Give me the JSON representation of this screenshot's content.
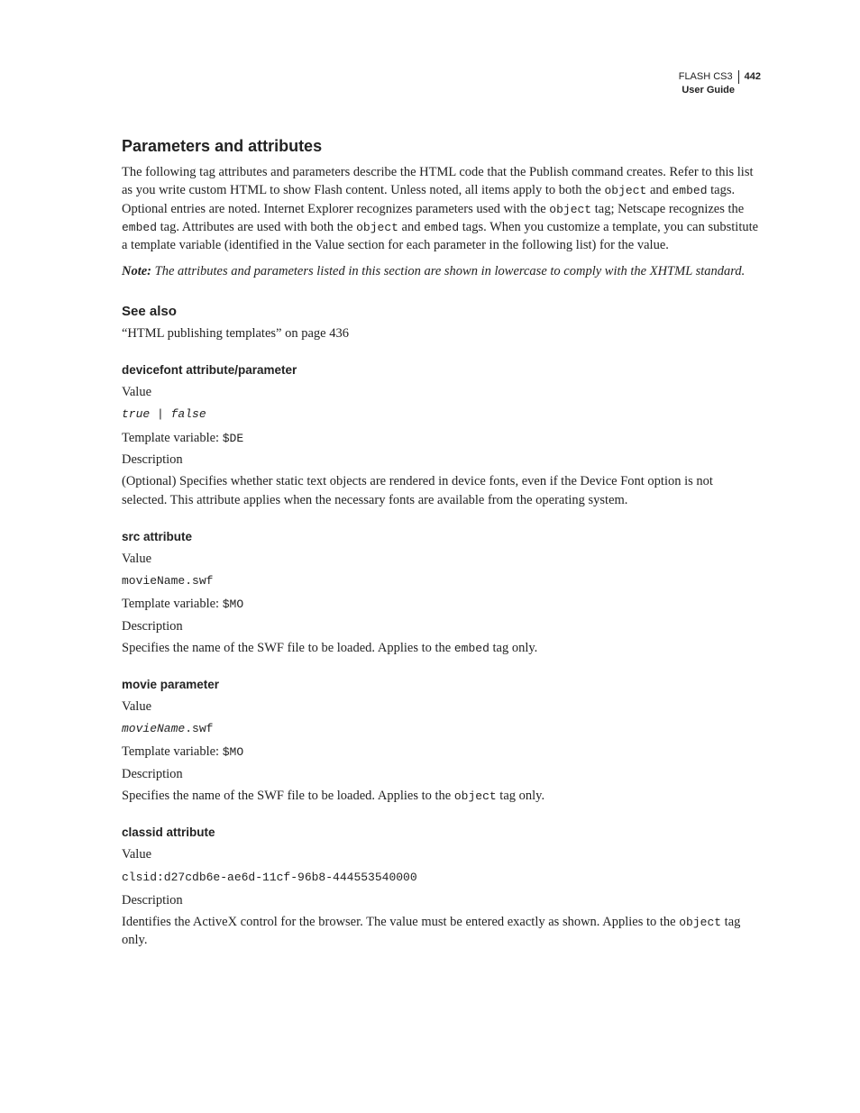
{
  "header": {
    "product": "FLASH CS3",
    "page_number": "442",
    "subtitle": "User Guide"
  },
  "main_heading": "Parameters and attributes",
  "intro": {
    "p1a": "The following tag attributes and parameters describe the HTML code that the Publish command creates. Refer to this list as you write custom HTML to show Flash content. Unless noted, all items apply to both the ",
    "code1": "object",
    "p1b": " and ",
    "code2": "embed",
    "p1c": " tags. Optional entries are noted. Internet Explorer recognizes parameters used with the ",
    "code3": "object",
    "p1d": " tag; Netscape recognizes the ",
    "code4": "embed",
    "p1e": " tag. Attributes are used with both the ",
    "code5": "object",
    "p1f": " and ",
    "code6": "embed",
    "p1g": " tags. When you customize a template, you can substitute a template variable (identified in the Value section for each parameter in the following list) for the value."
  },
  "note": {
    "label": "Note:",
    "text": " The attributes and parameters listed in this section are shown in lowercase to comply with the XHTML standard."
  },
  "see_also": {
    "heading": "See also",
    "link": "“HTML publishing templates” on page 436"
  },
  "sections": {
    "devicefont": {
      "heading": "devicefont attribute/parameter",
      "value_label": "Value",
      "value_code": "true | false",
      "tpl_prefix": "Template variable: ",
      "tpl_code": "$DE",
      "desc_label": "Description",
      "desc_text": "(Optional) Specifies whether static text objects are rendered in device fonts, even if the Device Font option is not selected. This attribute applies when the necessary fonts are available from the operating system."
    },
    "src": {
      "heading": "src attribute",
      "value_label": "Value",
      "value_code": "movieName.swf",
      "tpl_prefix": "Template variable: ",
      "tpl_code": "$MO",
      "desc_label": "Description",
      "desc_a": "Specifies the name of the SWF file to be loaded. Applies to the ",
      "desc_code": "embed",
      "desc_b": " tag only."
    },
    "movie": {
      "heading": "movie parameter",
      "value_label": "Value",
      "value_code_i": "movieName",
      "value_code_ext": ".swf",
      "tpl_prefix": "Template variable: ",
      "tpl_code": "$MO",
      "desc_label": "Description",
      "desc_a": "Specifies the name of the SWF file to be loaded. Applies to the ",
      "desc_code": "object",
      "desc_b": " tag only."
    },
    "classid": {
      "heading": "classid attribute",
      "value_label": "Value",
      "value_code": "clsid:d27cdb6e-ae6d-11cf-96b8-444553540000",
      "desc_label": "Description",
      "desc_a": "Identifies the ActiveX control for the browser. The value must be entered exactly as shown. Applies to the ",
      "desc_code": "object",
      "desc_b": " tag only."
    }
  }
}
